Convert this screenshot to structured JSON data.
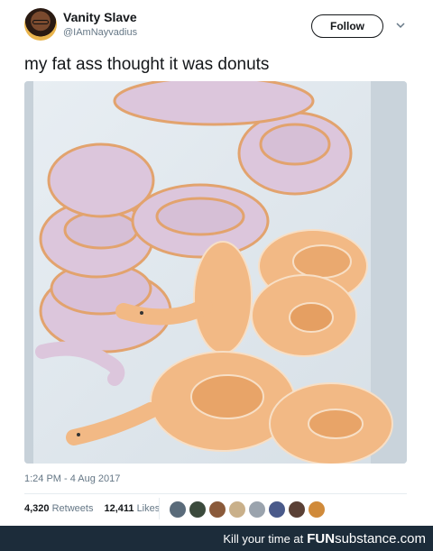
{
  "user": {
    "display_name": "Vanity Slave",
    "handle": "@IAmNayvadius"
  },
  "follow_label": "Follow",
  "tweet": {
    "text": "my fat ass thought it was donuts",
    "timestamp": "1:24 PM - 4 Aug 2017"
  },
  "stats": {
    "retweets_count": "4,320",
    "retweets_label": "Retweets",
    "likes_count": "12,411",
    "likes_label": "Likes"
  },
  "liker_avatars": [
    "#5a6b7a",
    "#3b4a3c",
    "#8a5a3a",
    "#c9b08a",
    "#9aa3ad",
    "#4a5a8a",
    "#5a4035",
    "#d08a3a"
  ],
  "footer": {
    "tagline": "Kill your time at",
    "brand_main": "FUN",
    "brand_sub": "substance",
    "brand_com": ".com"
  },
  "colors": {
    "accent": "#1da1f2",
    "footer_bg": "#1c2c3a",
    "snake_lavender": "#ddc9dd",
    "snake_orange": "#f0b683"
  }
}
